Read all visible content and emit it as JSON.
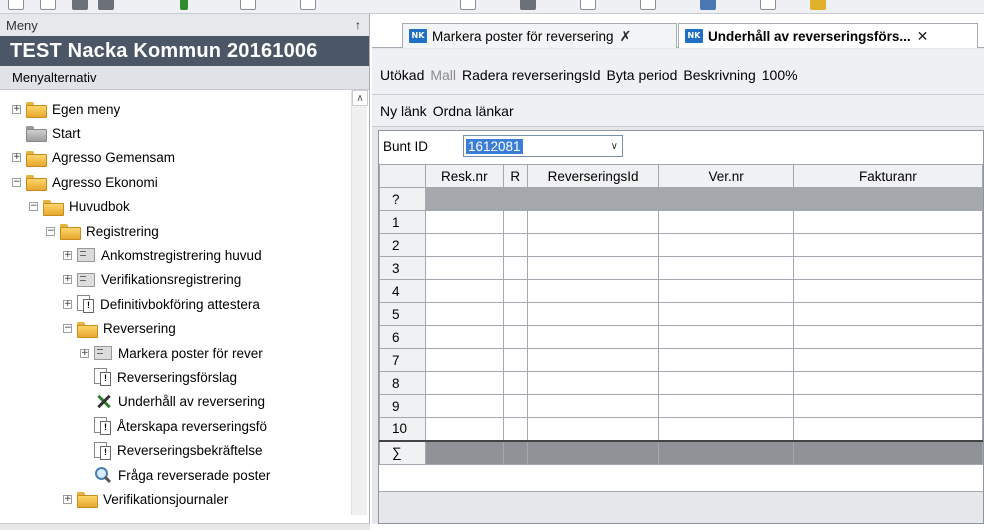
{
  "menu": {
    "header": "Meny",
    "pin_glyph": "↑",
    "company": "TEST Nacka Kommun 20161006",
    "subtitle": "Menyalternativ",
    "tree": [
      {
        "label": "Egen meny",
        "icon": "folder-icon",
        "expander": "+"
      },
      {
        "label": "Start",
        "icon": "folder-gray-icon",
        "expander": ""
      },
      {
        "label": "Agresso Gemensam",
        "icon": "folder-icon",
        "expander": "+"
      },
      {
        "label": "Agresso Ekonomi",
        "icon": "folder-open-icon",
        "expander": "−"
      },
      {
        "label": "Huvudbok",
        "icon": "folder-open-icon",
        "expander": "−"
      },
      {
        "label": "Registrering",
        "icon": "folder-open-icon",
        "expander": "−"
      },
      {
        "label": "Ankomstregistrering huvud",
        "icon": "form-icon",
        "expander": "+"
      },
      {
        "label": "Verifikationsregistrering",
        "icon": "form-icon",
        "expander": "+"
      },
      {
        "label": "Definitivbokföring attestera",
        "icon": "report-icon",
        "expander": "+"
      },
      {
        "label": "Reversering",
        "icon": "folder-open-icon",
        "expander": "−"
      },
      {
        "label": "Markera poster för rever",
        "icon": "form-icon",
        "expander": "+"
      },
      {
        "label": "Reverseringsförslag",
        "icon": "report-icon",
        "expander": ""
      },
      {
        "label": "Underhåll av reversering",
        "icon": "tool-icon",
        "expander": ""
      },
      {
        "label": "Återskapa reverseringsfö",
        "icon": "report-icon",
        "expander": ""
      },
      {
        "label": "Reverseringsbekräftelse",
        "icon": "report-icon",
        "expander": ""
      },
      {
        "label": "Fråga reverserade poster",
        "icon": "search-icon",
        "expander": ""
      },
      {
        "label": "Verifikationsjournaler",
        "icon": "folder-icon",
        "expander": "+"
      }
    ]
  },
  "tabs": [
    {
      "label": "Markera poster för reversering",
      "icon_text": "NK",
      "close": "✗",
      "active": false
    },
    {
      "label": "Underhåll av reverseringsförs...",
      "icon_text": "NK",
      "close": "✕",
      "active": true
    }
  ],
  "actions": {
    "row1": [
      "Utökad",
      "Mall",
      "Radera reverseringsId",
      "Byta period",
      "Beskrivning",
      "100%"
    ],
    "row1_disabled": [
      false,
      true,
      false,
      false,
      false,
      false
    ],
    "row2": [
      "Ny länk",
      "Ordna länkar"
    ]
  },
  "form": {
    "bunt_label": "Bunt ID",
    "bunt_value": "1612081",
    "dropdown_glyph": "∨"
  },
  "grid": {
    "columns": [
      "Resk.nr",
      "R",
      "ReverseringsId",
      "Ver.nr",
      "Fakturanr"
    ],
    "row_headers": [
      "?",
      "1",
      "2",
      "3",
      "4",
      "5",
      "6",
      "7",
      "8",
      "9",
      "10",
      "∑"
    ]
  }
}
